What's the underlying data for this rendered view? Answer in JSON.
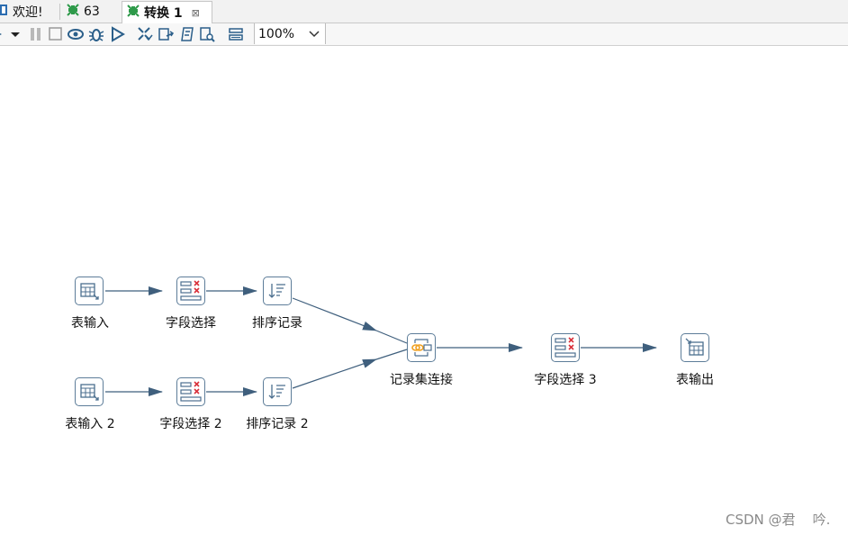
{
  "tabs": [
    {
      "label": "欢迎!",
      "icon": "welcome-icon",
      "active": false
    },
    {
      "label": "63",
      "icon": "transformation-icon",
      "active": false
    },
    {
      "label": "转换 1",
      "icon": "transformation-icon",
      "active": true,
      "close": "⊠"
    }
  ],
  "toolbar": {
    "zoom_value": "100%",
    "buttons": [
      "run-icon",
      "run-dropdown-icon",
      "pause-icon",
      "stop-icon",
      "preview-icon",
      "debug-icon",
      "replay-icon",
      "verify-icon",
      "impact-analysis-icon",
      "sql-icon",
      "explore-db-icon",
      "show-results-icon"
    ]
  },
  "steps": [
    {
      "id": "table-input-1",
      "label": "表输入",
      "icon": "table-input-icon"
    },
    {
      "id": "select-values-1",
      "label": "字段选择",
      "icon": "select-values-icon"
    },
    {
      "id": "sort-rows-1",
      "label": "排序记录",
      "icon": "sort-rows-icon"
    },
    {
      "id": "table-input-2",
      "label": "表输入 2",
      "icon": "table-input-icon"
    },
    {
      "id": "select-values-2",
      "label": "字段选择 2",
      "icon": "select-values-icon"
    },
    {
      "id": "sort-rows-2",
      "label": "排序记录 2",
      "icon": "sort-rows-icon"
    },
    {
      "id": "merge-join",
      "label": "记录集连接",
      "icon": "merge-join-icon"
    },
    {
      "id": "select-values-3",
      "label": "字段选择 3",
      "icon": "select-values-icon"
    },
    {
      "id": "table-output",
      "label": "表输出",
      "icon": "table-output-icon"
    }
  ],
  "hops": [
    [
      "table-input-1",
      "select-values-1"
    ],
    [
      "select-values-1",
      "sort-rows-1"
    ],
    [
      "sort-rows-1",
      "merge-join"
    ],
    [
      "table-input-2",
      "select-values-2"
    ],
    [
      "select-values-2",
      "sort-rows-2"
    ],
    [
      "sort-rows-2",
      "merge-join"
    ],
    [
      "merge-join",
      "select-values-3"
    ],
    [
      "select-values-3",
      "table-output"
    ]
  ],
  "colors": {
    "hop": "#3f5f7d",
    "step_border": "#5d7d99",
    "accent_red": "#d9303a",
    "accent_green": "#2e9a4a",
    "merge_orange": "#f0a020"
  },
  "watermark": "CSDN @君    吟."
}
